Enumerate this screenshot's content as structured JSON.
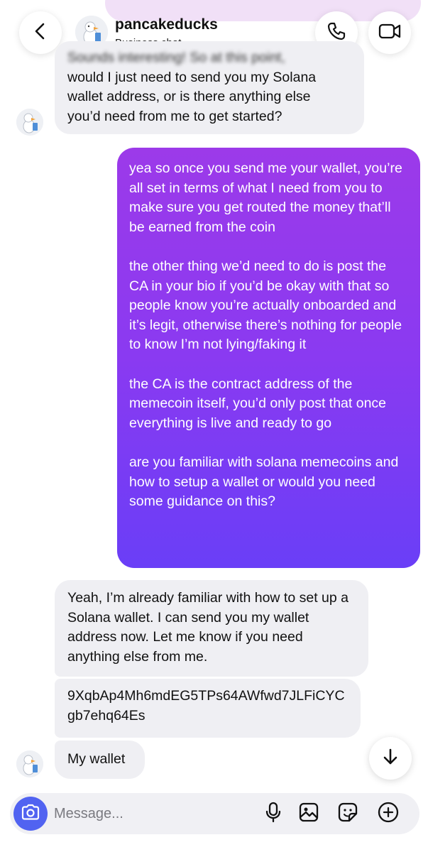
{
  "header": {
    "name": "pancakeducks",
    "subtitle": "Business chat"
  },
  "icons": {
    "back": "chevron-left-icon",
    "call": "phone-icon",
    "video": "video-camera-icon",
    "scroll": "arrow-down-icon",
    "camera": "camera-icon",
    "mic": "microphone-icon",
    "gallery": "image-icon",
    "sticker": "sticker-icon",
    "add": "plus-circle-icon"
  },
  "colors": {
    "outgoing_top": "#9c3ae9",
    "outgoing_bottom": "#6a3ef7",
    "incoming_bg": "#efeff3",
    "camera_button": "#5163f1"
  },
  "messages": {
    "incoming_first": {
      "blurred_line": "Sounds interesting! So at this point,",
      "lines": [
        "would I just need to send you my Solana",
        "wallet address, or is there anything else",
        "you’d need from me to get started?"
      ]
    },
    "outgoing": {
      "paragraphs": [
        "yea so once you send me your wallet, you’re all set in terms of what I need from you to make sure you get routed the money that’ll be earned from the coin",
        "the other thing we’d need to do is post the CA in your bio if you’d be okay with that so people know you’re actually onboarded and it’s legit, otherwise there’s nothing for people to know I’m not lying/faking it",
        "the CA is the contract address of the memecoin itself, you’d only post that once everything is live and ready to go",
        "are you familiar with solana memecoins and how to setup a wallet or would you need some guidance on this?"
      ]
    },
    "reply": "Yeah, I’m already familiar with how to set up a Solana wallet. I can send you my wallet address now. Let me know if you need anything else from me.",
    "wallet_address": "9XqbAp4Mh6mdEG5TPs64AWfwd7JLFiCYCgb7ehq64Es",
    "wallet_note": "My wallet"
  },
  "composer": {
    "placeholder": "Message..."
  }
}
